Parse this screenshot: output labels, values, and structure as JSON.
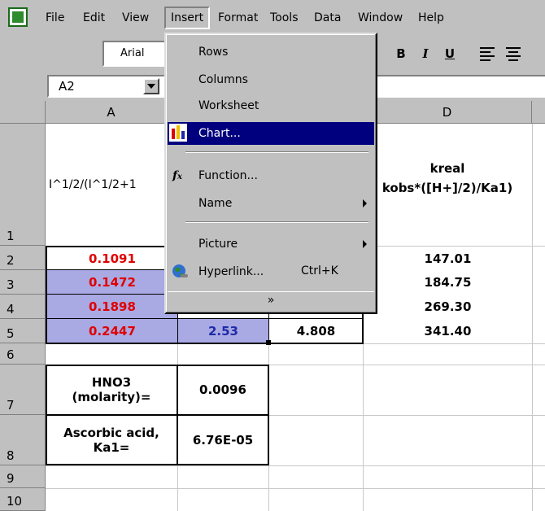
{
  "menubar": {
    "items": [
      {
        "label": "File"
      },
      {
        "label": "Edit"
      },
      {
        "label": "View"
      },
      {
        "label": "Insert"
      },
      {
        "label": "Format"
      },
      {
        "label": "Tools"
      },
      {
        "label": "Data"
      },
      {
        "label": "Window"
      },
      {
        "label": "Help"
      }
    ]
  },
  "toolbar": {
    "font_name": "Arial",
    "bold": "B",
    "italic": "I",
    "underline": "U"
  },
  "formula_bar": {
    "name_box": "A2",
    "value": ""
  },
  "columns": [
    "A",
    "D"
  ],
  "rows": [
    "1",
    "2",
    "3",
    "4",
    "5",
    "6",
    "7",
    "8",
    "9",
    "10"
  ],
  "cells": {
    "A1": "I^1/2/(I^1/2+1",
    "D1_line1": "kreal",
    "D1_line2": "kobs*([H+]/2)/Ka1)",
    "A2": "0.1091",
    "A3": "0.1472",
    "A4": "0.1898",
    "A5": "0.2447",
    "B5": "2.53",
    "C5": "4.808",
    "D2": "147.01",
    "D3": "184.75",
    "D4": "269.30",
    "D5": "341.40",
    "A7": "HNO3 (molarity)=",
    "B7": "0.0096",
    "A8": "Ascorbic acid, Ka1=",
    "B8": "6.76E-05"
  },
  "insert_menu": {
    "rows": "Rows",
    "columns": "Columns",
    "worksheet": "Worksheet",
    "chart": "Chart...",
    "function": "Function...",
    "name": "Name",
    "picture": "Picture",
    "hyperlink": "Hyperlink...",
    "hyperlink_shortcut": "Ctrl+K",
    "expand": "»"
  },
  "colors": {
    "highlight": "#00007f",
    "selection": "#a9a9e4",
    "red_text": "#e00000",
    "blue_text": "#1e2aa8"
  }
}
